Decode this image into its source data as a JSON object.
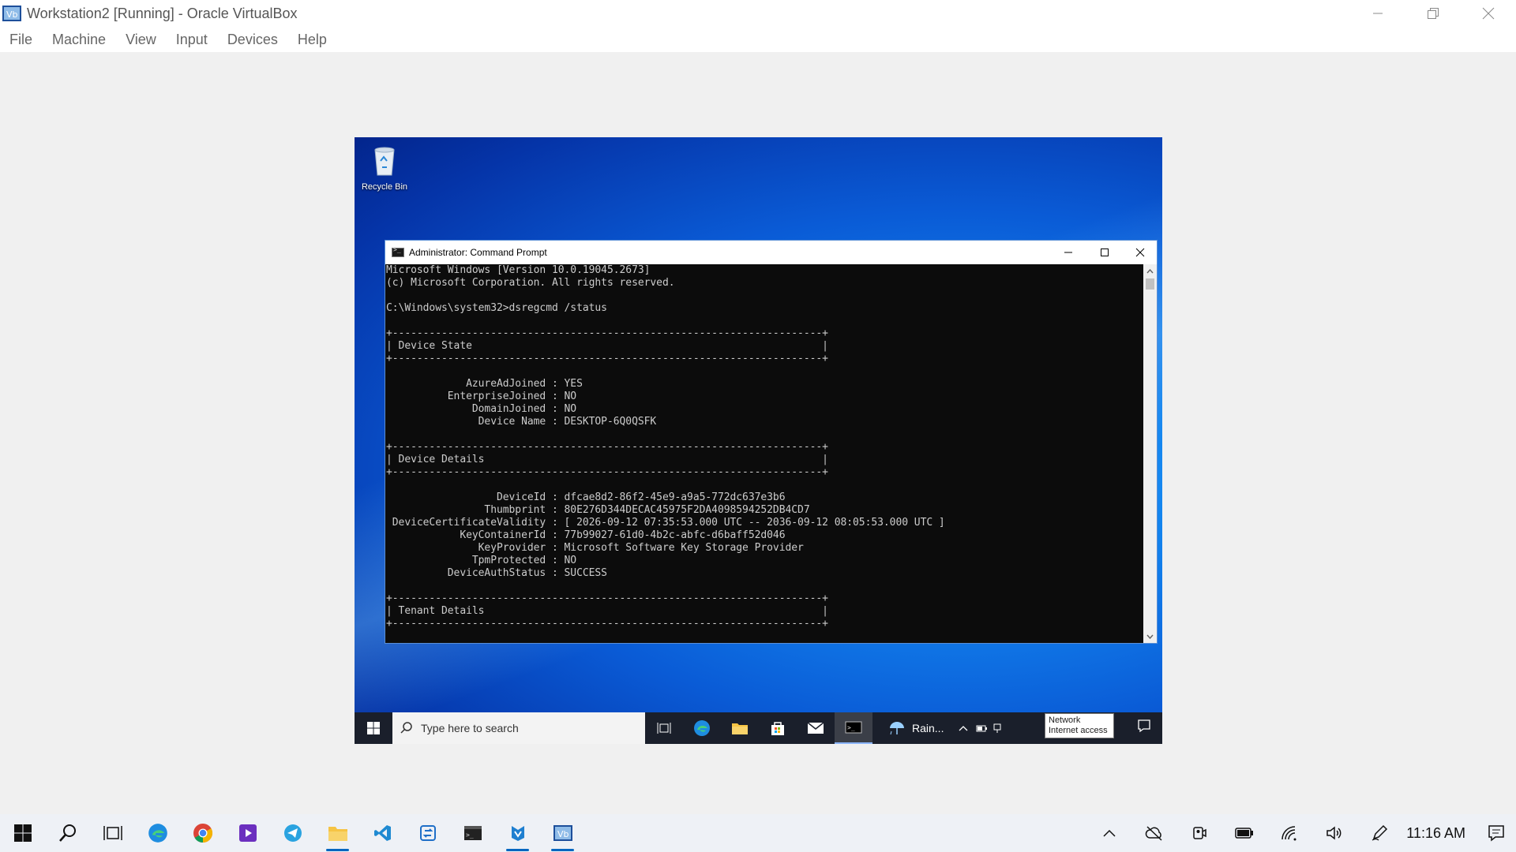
{
  "host_window": {
    "title": "Workstation2 [Running] - Oracle VirtualBox",
    "menu": [
      "File",
      "Machine",
      "View",
      "Input",
      "Devices",
      "Help"
    ]
  },
  "guest": {
    "desktop": {
      "recycle_bin_label": "Recycle Bin"
    },
    "cmd_window": {
      "title": "Administrator: Command Prompt",
      "output_lines": [
        "Microsoft Windows [Version 10.0.19045.2673]",
        "(c) Microsoft Corporation. All rights reserved.",
        "",
        "C:\\Windows\\system32>dsregcmd /status",
        "",
        "+----------------------------------------------------------------------+",
        "| Device State                                                         |",
        "+----------------------------------------------------------------------+",
        "",
        "             AzureAdJoined : YES",
        "          EnterpriseJoined : NO",
        "              DomainJoined : NO",
        "               Device Name : DESKTOP-6Q0QSFK",
        "",
        "+----------------------------------------------------------------------+",
        "| Device Details                                                       |",
        "+----------------------------------------------------------------------+",
        "",
        "                  DeviceId : dfcae8d2-86f2-45e9-a9a5-772dc637e3b6",
        "                Thumbprint : 80E276D344DECAC45975F2DA4098594252DB4CD7",
        " DeviceCertificateValidity : [ 2026-09-12 07:35:53.000 UTC -- 2036-09-12 08:05:53.000 UTC ]",
        "            KeyContainerId : 77b99027-61d0-4b2c-abfc-d6baff52d046",
        "               KeyProvider : Microsoft Software Key Storage Provider",
        "              TpmProtected : NO",
        "          DeviceAuthStatus : SUCCESS",
        "",
        "+----------------------------------------------------------------------+",
        "| Tenant Details                                                       |",
        "+----------------------------------------------------------------------+"
      ]
    },
    "taskbar": {
      "search_placeholder": "Type here to search",
      "weather_text": "Rain...",
      "tooltip_line1": "Network",
      "tooltip_line2": "Internet access"
    }
  },
  "host_taskbar": {
    "time": "11:16 AM"
  },
  "colors": {
    "accent": "#0067c0",
    "cmd_bg": "#0c0c0c",
    "cmd_fg": "#cccccc"
  }
}
